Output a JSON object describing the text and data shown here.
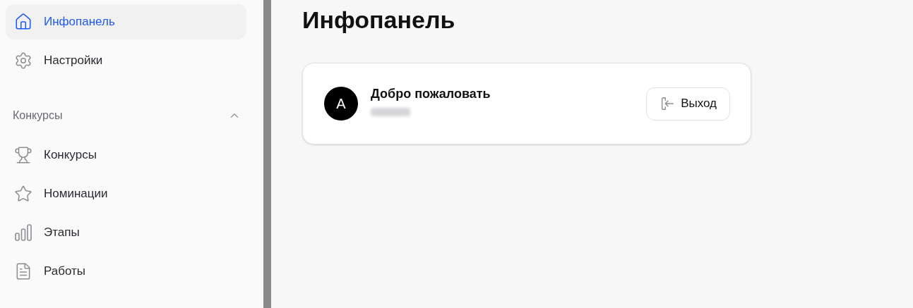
{
  "sidebar": {
    "items": [
      {
        "label": "Инфопанель",
        "selected": true
      },
      {
        "label": "Настройки",
        "selected": false
      }
    ],
    "group": {
      "label": "Конкурсы",
      "expanded": true,
      "items": [
        {
          "label": "Конкурсы",
          "selected": false
        },
        {
          "label": "Номинации",
          "selected": false
        },
        {
          "label": "Этапы",
          "selected": false
        },
        {
          "label": "Работы",
          "selected": false
        }
      ]
    }
  },
  "page": {
    "title": "Инфопанель"
  },
  "welcome_card": {
    "avatar": "A",
    "greeting": "Добро пожаловать",
    "logout_button": "Выход"
  }
}
